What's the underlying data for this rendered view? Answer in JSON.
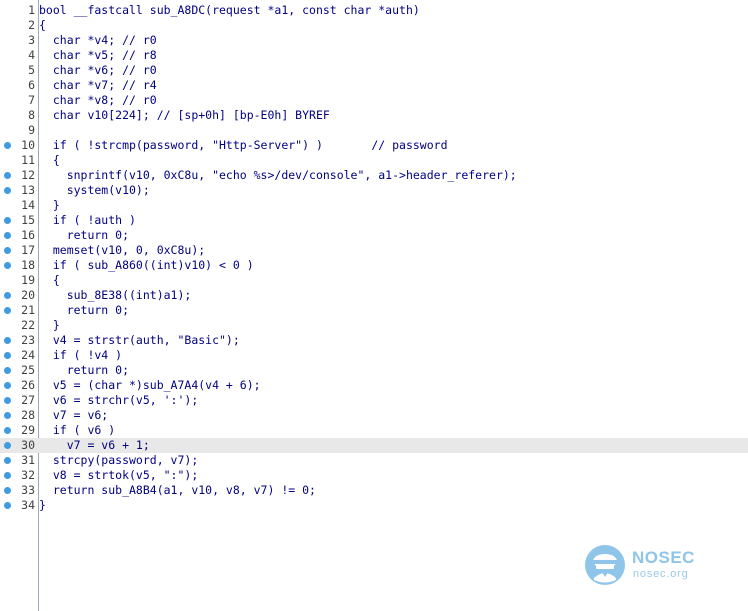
{
  "code_view": {
    "lines": [
      {
        "num": "1",
        "text": "bool __fastcall sub_A8DC(request *a1, const char *auth)",
        "breakpoint": false,
        "highlight": false
      },
      {
        "num": "2",
        "text": "{",
        "breakpoint": false,
        "highlight": false
      },
      {
        "num": "3",
        "text": "  char *v4; // r0",
        "breakpoint": false,
        "highlight": false
      },
      {
        "num": "4",
        "text": "  char *v5; // r8",
        "breakpoint": false,
        "highlight": false
      },
      {
        "num": "5",
        "text": "  char *v6; // r0",
        "breakpoint": false,
        "highlight": false
      },
      {
        "num": "6",
        "text": "  char *v7; // r4",
        "breakpoint": false,
        "highlight": false
      },
      {
        "num": "7",
        "text": "  char *v8; // r0",
        "breakpoint": false,
        "highlight": false
      },
      {
        "num": "8",
        "text": "  char v10[224]; // [sp+0h] [bp-E0h] BYREF",
        "breakpoint": false,
        "highlight": false
      },
      {
        "num": "9",
        "text": "",
        "breakpoint": false,
        "highlight": false
      },
      {
        "num": "10",
        "text": "  if ( !strcmp(password, \"Http-Server\") )       // password",
        "breakpoint": true,
        "highlight": false
      },
      {
        "num": "11",
        "text": "  {",
        "breakpoint": false,
        "highlight": false
      },
      {
        "num": "12",
        "text": "    snprintf(v10, 0xC8u, \"echo %s>/dev/console\", a1->header_referer);",
        "breakpoint": true,
        "highlight": false
      },
      {
        "num": "13",
        "text": "    system(v10);",
        "breakpoint": true,
        "highlight": false
      },
      {
        "num": "14",
        "text": "  }",
        "breakpoint": false,
        "highlight": false
      },
      {
        "num": "15",
        "text": "  if ( !auth )",
        "breakpoint": true,
        "highlight": false
      },
      {
        "num": "16",
        "text": "    return 0;",
        "breakpoint": true,
        "highlight": false
      },
      {
        "num": "17",
        "text": "  memset(v10, 0, 0xC8u);",
        "breakpoint": true,
        "highlight": false
      },
      {
        "num": "18",
        "text": "  if ( sub_A860((int)v10) < 0 )",
        "breakpoint": true,
        "highlight": false
      },
      {
        "num": "19",
        "text": "  {",
        "breakpoint": false,
        "highlight": false
      },
      {
        "num": "20",
        "text": "    sub_8E38((int)a1);",
        "breakpoint": true,
        "highlight": false
      },
      {
        "num": "21",
        "text": "    return 0;",
        "breakpoint": true,
        "highlight": false
      },
      {
        "num": "22",
        "text": "  }",
        "breakpoint": false,
        "highlight": false
      },
      {
        "num": "23",
        "text": "  v4 = strstr(auth, \"Basic\");",
        "breakpoint": true,
        "highlight": false
      },
      {
        "num": "24",
        "text": "  if ( !v4 )",
        "breakpoint": true,
        "highlight": false
      },
      {
        "num": "25",
        "text": "    return 0;",
        "breakpoint": true,
        "highlight": false
      },
      {
        "num": "26",
        "text": "  v5 = (char *)sub_A7A4(v4 + 6);",
        "breakpoint": true,
        "highlight": false
      },
      {
        "num": "27",
        "text": "  v6 = strchr(v5, ':');",
        "breakpoint": true,
        "highlight": false
      },
      {
        "num": "28",
        "text": "  v7 = v6;",
        "breakpoint": true,
        "highlight": false
      },
      {
        "num": "29",
        "text": "  if ( v6 )",
        "breakpoint": true,
        "highlight": false
      },
      {
        "num": "30",
        "text": "    v7 = v6 + 1;",
        "breakpoint": true,
        "highlight": true
      },
      {
        "num": "31",
        "text": "  strcpy(password, v7);",
        "breakpoint": true,
        "highlight": false
      },
      {
        "num": "32",
        "text": "  v8 = strtok(v5, \":\");",
        "breakpoint": true,
        "highlight": false
      },
      {
        "num": "33",
        "text": "  return sub_A8B4(a1, v10, v8, v7) != 0;",
        "breakpoint": true,
        "highlight": false
      },
      {
        "num": "34",
        "text": "}",
        "breakpoint": true,
        "highlight": false
      }
    ]
  },
  "colors": {
    "code": "#000080",
    "string": "#008000",
    "comment": "#008000",
    "breakpoint": "#3f9be0",
    "highlight_bg": "#e8e8e8"
  },
  "watermark": {
    "title": "NOSEC",
    "subtitle": "nosec.org",
    "icon": "helmet-person-icon"
  }
}
